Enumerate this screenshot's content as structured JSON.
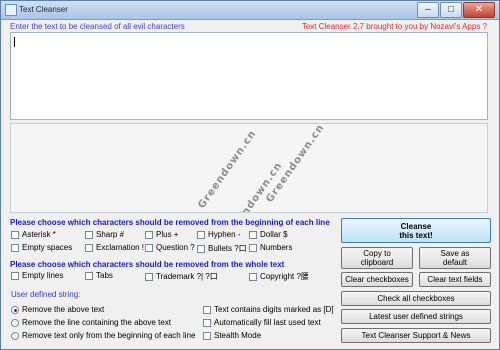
{
  "window": {
    "title": "Text Cleanser"
  },
  "header": {
    "prompt": "Enter the text to be cleansed of all evil characters",
    "brand": "Text Cleanser 2.7 brought to you by Nozavi's Apps ?"
  },
  "watermark": [
    "Greendown.cn",
    "Greendown.cn",
    "Greendown.cn"
  ],
  "section_begin": {
    "title": "Please choose which characters should be removed from the beginning of each line",
    "row1": [
      "Asterisk *",
      "Sharp #",
      "Plus +",
      "Hyphen -",
      "Dollar $"
    ],
    "row2": [
      "Empty spaces",
      "Exclamation !",
      "Question ?",
      "Bullets ?口",
      "Numbers"
    ]
  },
  "section_whole": {
    "title": "Please choose which characters should be removed from the whole text",
    "items": [
      "Empty lines",
      "Tabs",
      "Trademark ?| ?口",
      "Copyright ?腰"
    ]
  },
  "user_defined": {
    "label": "User defined string:",
    "radios": [
      "Remove the above text",
      "Remove the line containing the above text",
      "Remove text only from the beginning of each line"
    ],
    "options": [
      "Text contains digits marked as [D]",
      "Automatically fill last used text",
      "Stealth Mode"
    ]
  },
  "buttons": {
    "cleanse": [
      "Cleanse",
      "this text!"
    ],
    "copy": [
      "Copy to",
      "clipboard"
    ],
    "save": [
      "Save as",
      "default"
    ],
    "clear_checkboxes": "Clear checkboxes",
    "clear_fields": "Clear text fields",
    "check_all": "Check all checkboxes",
    "latest": "Latest user defined strings",
    "support": "Text Cleanser Support & News"
  }
}
